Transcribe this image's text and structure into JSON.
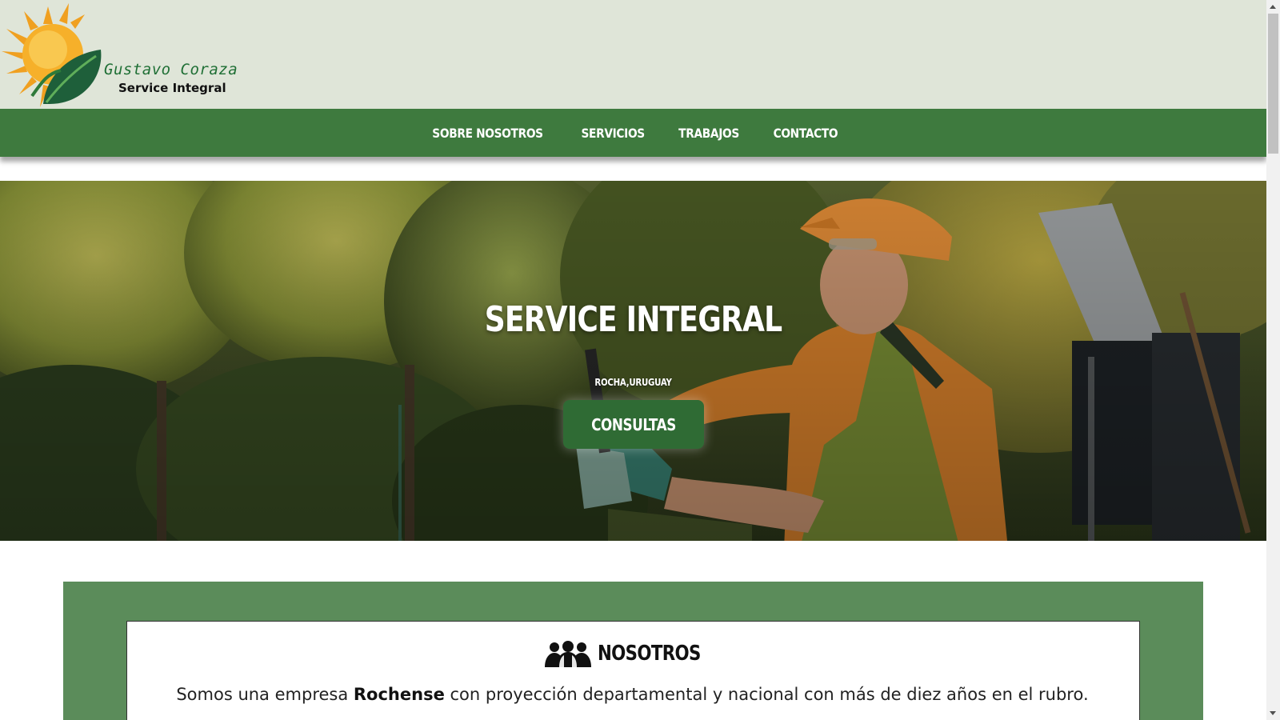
{
  "header": {
    "logo": {
      "name": "Gustavo Coraza",
      "subtitle": "Service Integral"
    }
  },
  "nav": {
    "items": [
      {
        "label": "SOBRE NOSOTROS"
      },
      {
        "label": "SERVICIOS"
      },
      {
        "label": "TRABAJOS"
      },
      {
        "label": "CONTACTO"
      }
    ]
  },
  "hero": {
    "title": "SERVICE INTEGRAL",
    "location": "ROCHA,URUGUAY",
    "button_label": "CONSULTAS"
  },
  "about": {
    "title": "NOSOTROS",
    "icon": "people-icon",
    "text_before": "Somos una empresa ",
    "text_bold": "Rochense",
    "text_after": " con proyección departamental y nacional con más de diez años en el rubro."
  },
  "colors": {
    "header_bg": "#dfe5d8",
    "nav_bg": "#3e7a3e",
    "button_bg": "#2f6b34",
    "band_bg": "#5b8c5a"
  }
}
